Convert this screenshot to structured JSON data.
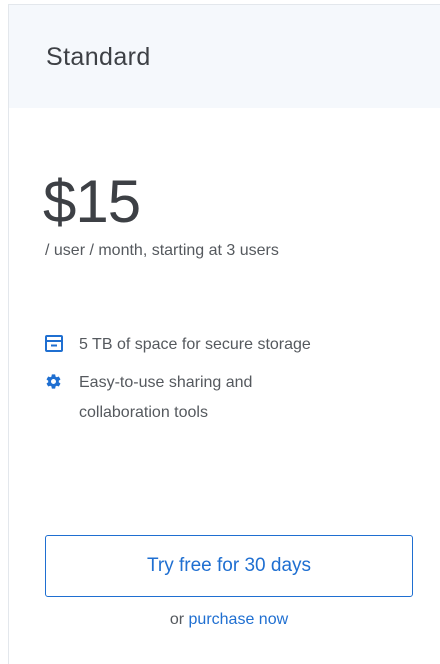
{
  "plan": {
    "name": "Standard",
    "price": "$15",
    "price_note": "/ user / month, starting at 3 users"
  },
  "features": [
    {
      "icon": "storage-box-icon",
      "text": "5 TB of space for secure storage"
    },
    {
      "icon": "gear-icon",
      "text": "Easy-to-use sharing and collaboration tools"
    }
  ],
  "cta": {
    "label": "Try free for 30 days"
  },
  "purchase": {
    "prefix": "or",
    "link_label": "purchase now"
  },
  "colors": {
    "accent": "#1f6fd1",
    "header_bg": "#f5f8fc",
    "text": "#55595e"
  }
}
